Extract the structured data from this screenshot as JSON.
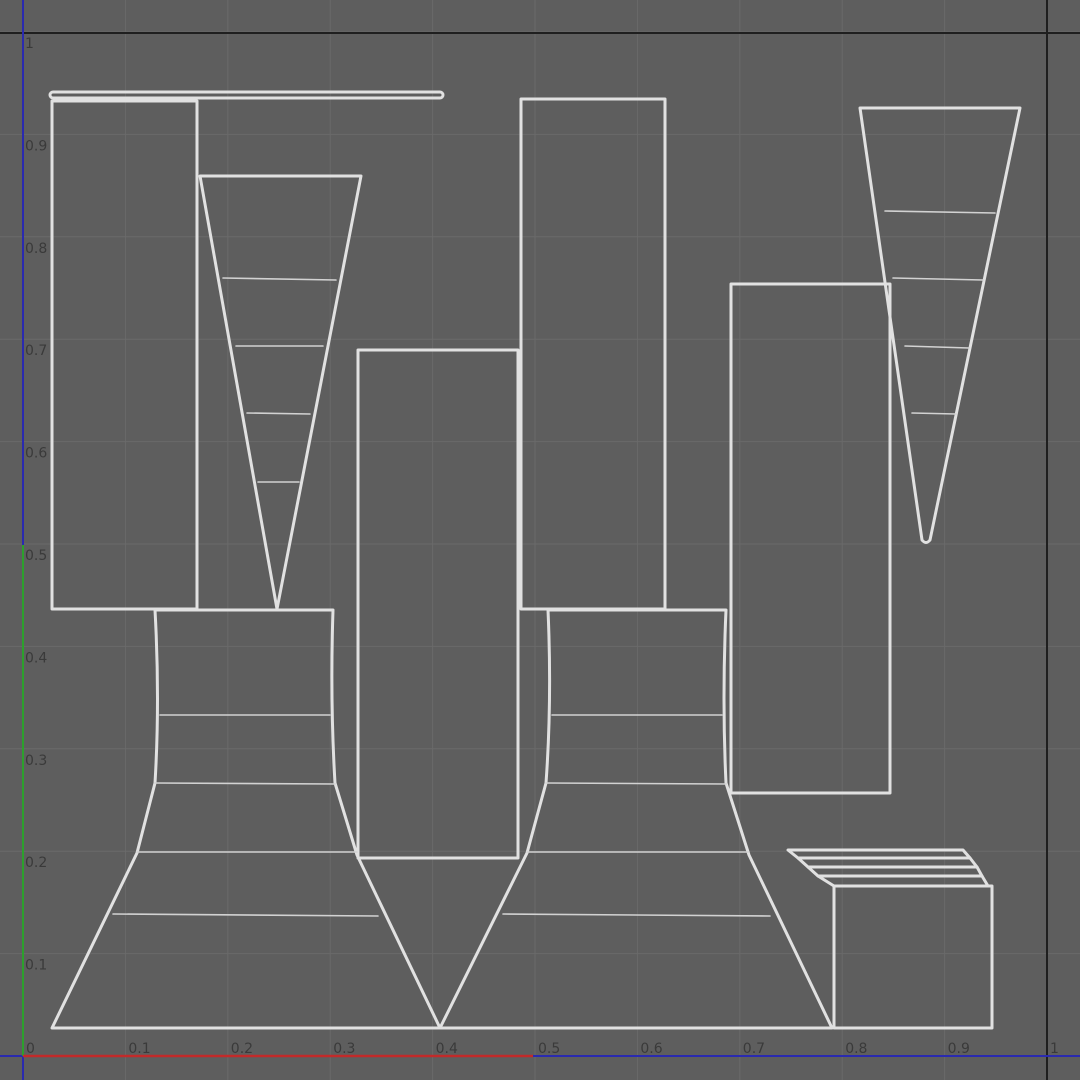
{
  "uv_editor": {
    "u_tick_labels": [
      "0",
      "0.1",
      "0.2",
      "0.3",
      "0.4",
      "0.5",
      "0.6",
      "0.7",
      "0.8",
      "0.9",
      "1"
    ],
    "v_tick_labels": [
      "0.1",
      "0.2",
      "0.3",
      "0.4",
      "0.5",
      "0.6",
      "0.7",
      "0.8",
      "0.9",
      "1"
    ],
    "colors": {
      "background": "#5e5e5e",
      "grid": "#6a6a6a",
      "boundary": "#1f1f1f",
      "u_axis": "#c22a2a",
      "v_axis": "#2ca02c",
      "blue_axis": "#2a2ab0",
      "uv_edges": "#e1e1e1"
    }
  }
}
